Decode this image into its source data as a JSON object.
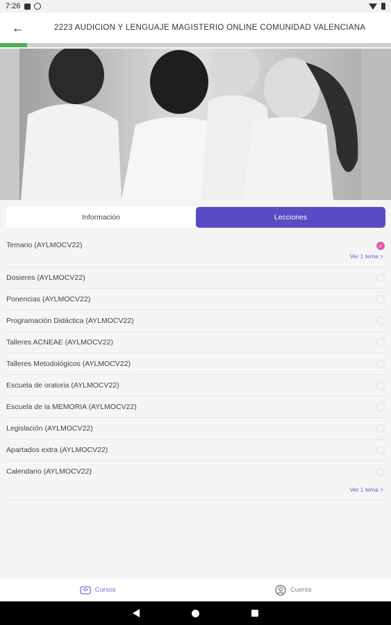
{
  "status_bar": {
    "time": "7:26"
  },
  "header": {
    "back_icon": "arrow-left-icon",
    "title": "2223 AUDICION Y LENGUAJE MAGISTERIO ONLINE COMUNIDAD VALENCIANA"
  },
  "progress": {
    "value": 0.07,
    "color": "#4caf50"
  },
  "hero": {
    "image": "children-in-white-uniforms-photo"
  },
  "tabs": [
    {
      "label": "Información",
      "active": false
    },
    {
      "label": "Lecciones",
      "active": true
    }
  ],
  "lessons": [
    {
      "label": "Temario (AYLMOCV22)",
      "completed": true,
      "link": "Ver 1 tema >"
    },
    {
      "label": "Dosieres (AYLMOCV22)",
      "completed": false
    },
    {
      "label": "Ponencias (AYLMOCV22)",
      "completed": false
    },
    {
      "label": "Programación Didáctica (AYLMOCV22)",
      "completed": false
    },
    {
      "label": "Talleres ACNEAE (AYLMOCV22)",
      "completed": false
    },
    {
      "label": "Talleres Metodológicos (AYLMOCV22)",
      "completed": false
    },
    {
      "label": "Escuela de oratoria (AYLMOCV22)",
      "completed": false
    },
    {
      "label": "Escuela de la MEMORIA (AYLMOCV22)",
      "completed": false
    },
    {
      "label": "Legislación (AYLMOCV22)",
      "completed": false
    },
    {
      "label": "Apartados extra (AYLMOCV22)",
      "completed": false
    },
    {
      "label": "Calendario (AYLMOCV22)",
      "completed": false,
      "link": "Ver 1 tema >"
    }
  ],
  "bottom_nav": [
    {
      "label": "Cursos",
      "icon": "courses-icon",
      "active": true
    },
    {
      "label": "Cuenta",
      "icon": "account-icon",
      "active": false
    }
  ],
  "colors": {
    "accent": "#5a4bc4",
    "check": "#e15ab5",
    "link": "#6a5ac9"
  }
}
